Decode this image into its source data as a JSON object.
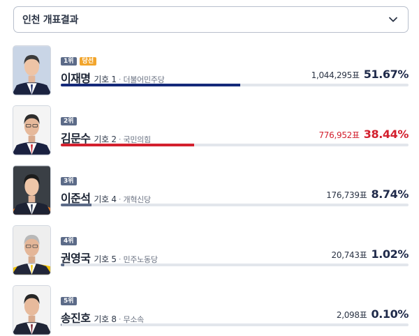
{
  "region_select": {
    "label": "인천 개표결과",
    "icon": "chevron-down-icon"
  },
  "candidates": [
    {
      "rank": "1위",
      "winner_label": "당선",
      "name": "이재명",
      "number": "기호 1",
      "party": "더불어민주당",
      "votes": "1,044,295표",
      "percent": "51.67",
      "percent_sign": "%",
      "share": 0.5167,
      "bar_color": "#152a7a",
      "value_color": "#1f2a4a"
    },
    {
      "rank": "2위",
      "name": "김문수",
      "number": "기호 2",
      "party": "국민의힘",
      "votes": "776,952표",
      "percent": "38.44",
      "percent_sign": "%",
      "share": 0.3844,
      "bar_color": "#d3202e",
      "value_color": "#d3202e"
    },
    {
      "rank": "3위",
      "name": "이준석",
      "number": "기호 4",
      "party": "개혁신당",
      "votes": "176,739표",
      "percent": "8.74",
      "percent_sign": "%",
      "share": 0.0874,
      "bar_color": "#5c6b88",
      "value_color": "#1f2a4a"
    },
    {
      "rank": "4위",
      "name": "권영국",
      "number": "기호 5",
      "party": "민주노동당",
      "votes": "20,743표",
      "percent": "1.02",
      "percent_sign": "%",
      "share": 0.0102,
      "bar_color": "#5c6b88",
      "value_color": "#1f2a4a"
    },
    {
      "rank": "5위",
      "name": "송진호",
      "number": "기호 8",
      "party": "무소속",
      "votes": "2,098표",
      "percent": "0.10",
      "percent_sign": "%",
      "share": 0.001,
      "bar_color": "#5c6b88",
      "value_color": "#1f2a4a"
    }
  ]
}
